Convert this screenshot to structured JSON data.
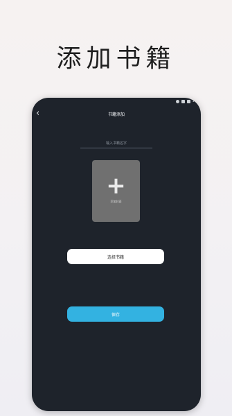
{
  "headline": "添加书籍",
  "status_bar": {
    "battery": "10"
  },
  "nav": {
    "title": "书籍添加"
  },
  "form": {
    "name_placeholder": "输入书籍名字",
    "cover_label": "添加封面",
    "select_label": "选择书籍",
    "save_label": "保存"
  },
  "colors": {
    "screen_bg": "#1e232b",
    "cover_bg": "#707070",
    "save_button": "#33b2e1",
    "select_button": "#ffffff"
  }
}
